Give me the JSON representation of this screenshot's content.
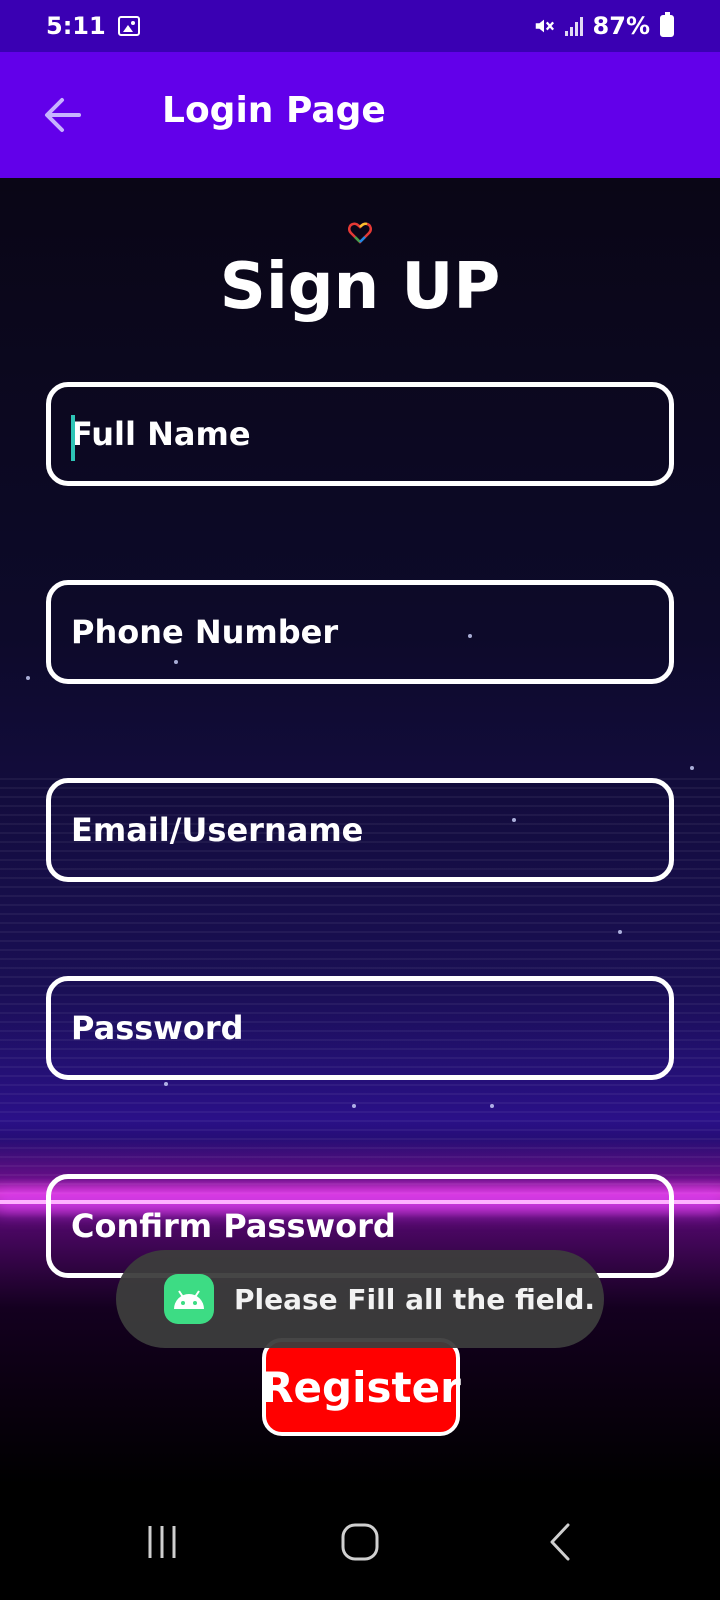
{
  "status_bar": {
    "time": "5:11",
    "battery": "87%"
  },
  "app_bar": {
    "title": "Login Page",
    "back_icon": "arrow-left-icon"
  },
  "form": {
    "heading": "Sign UP",
    "fields": [
      {
        "placeholder": "Full Name"
      },
      {
        "placeholder": "Phone Number"
      },
      {
        "placeholder": "Email/Username"
      },
      {
        "placeholder": "Password"
      },
      {
        "placeholder": "Confirm Password"
      }
    ],
    "submit_label": "Register"
  },
  "toast": {
    "message": "Please Fill all the field.",
    "icon": "android-icon"
  },
  "nav_bar": {
    "recents_icon": "recents-icon",
    "home_icon": "home-icon",
    "back_icon": "back-icon"
  },
  "colors": {
    "status_bar": "#3a00b3",
    "app_bar": "#6200ea",
    "register_button": "#ff0000",
    "cursor": "#2ec4b6",
    "toast_icon": "#3ddc84"
  }
}
